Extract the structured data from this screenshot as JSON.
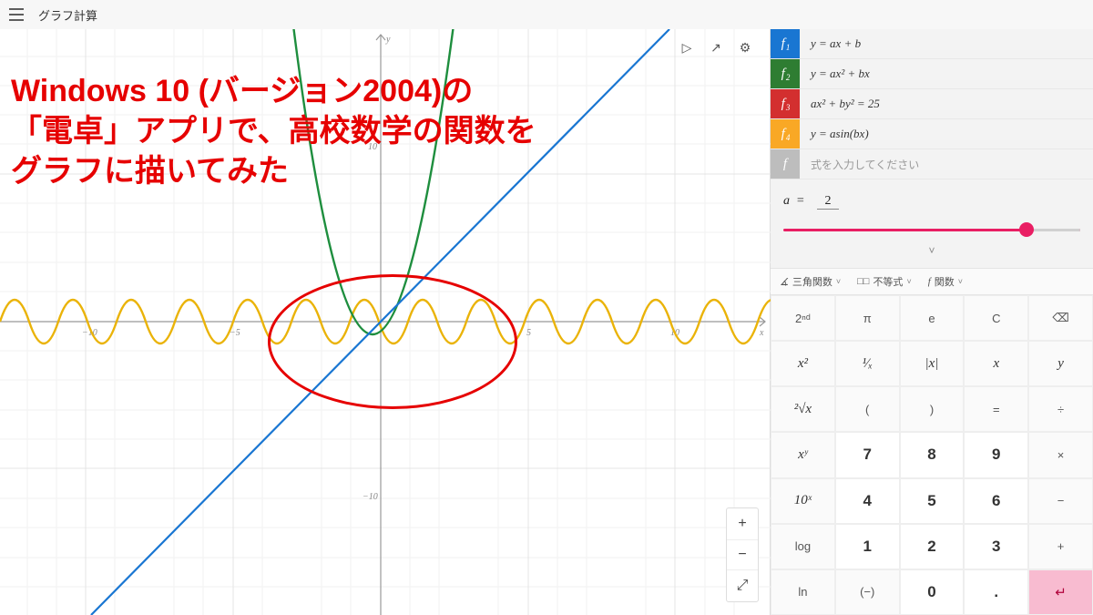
{
  "title": "グラフ計算",
  "overlay_text": "Windows 10 (バージョン2004)の\n「電卓」アプリで、高校数学の関数を\nグラフに描いてみた",
  "graph_tools": {
    "trace": "▷",
    "share": "↗",
    "options": "⚙"
  },
  "zoom": {
    "in": "+",
    "out": "−",
    "fit": "⤢"
  },
  "axes": {
    "x_ticks": [
      -10,
      -5,
      5,
      10
    ],
    "y_ticks": [
      10,
      -10
    ],
    "x_label": "x",
    "y_label": "y"
  },
  "functions": [
    {
      "color": "#1976d2",
      "chip": "f",
      "sub": "1",
      "expr_html": "y = ax + b"
    },
    {
      "color": "#2e7d32",
      "chip": "f",
      "sub": "2",
      "expr_html": "y = ax² + bx"
    },
    {
      "color": "#d32f2f",
      "chip": "f",
      "sub": "3",
      "expr_html": "ax² + by² = 25"
    },
    {
      "color": "#f9a825",
      "chip": "f",
      "sub": "4",
      "expr_html": "y = asin(bx)"
    }
  ],
  "input_placeholder": "式を入力してください",
  "slider": {
    "var": "a",
    "eq": "=",
    "value": "2",
    "position": 0.82
  },
  "categories": [
    {
      "icon": "∡",
      "label": "三角関数"
    },
    {
      "icon": "□□",
      "label": "不等式"
    },
    {
      "icon": "f",
      "label": "関数"
    }
  ],
  "keypad": [
    [
      {
        "t": "2ⁿᵈ",
        "k": "func"
      },
      {
        "t": "π",
        "k": "func"
      },
      {
        "t": "e",
        "k": "func"
      },
      {
        "t": "C",
        "k": "func"
      },
      {
        "t": "⌫",
        "k": "func"
      }
    ],
    [
      {
        "t": "x²",
        "k": "sym"
      },
      {
        "t": "¹⁄ₓ",
        "k": "sym"
      },
      {
        "t": "|x|",
        "k": "sym"
      },
      {
        "t": "x",
        "k": "sym"
      },
      {
        "t": "y",
        "k": "sym"
      }
    ],
    [
      {
        "t": "²√x",
        "k": "sym"
      },
      {
        "t": "(",
        "k": "func"
      },
      {
        "t": ")",
        "k": "func"
      },
      {
        "t": "=",
        "k": "func"
      },
      {
        "t": "÷",
        "k": "func"
      }
    ],
    [
      {
        "t": "xʸ",
        "k": "sym"
      },
      {
        "t": "7",
        "k": "num"
      },
      {
        "t": "8",
        "k": "num"
      },
      {
        "t": "9",
        "k": "num"
      },
      {
        "t": "×",
        "k": "func"
      }
    ],
    [
      {
        "t": "10ˣ",
        "k": "sym"
      },
      {
        "t": "4",
        "k": "num"
      },
      {
        "t": "5",
        "k": "num"
      },
      {
        "t": "6",
        "k": "num"
      },
      {
        "t": "−",
        "k": "func"
      }
    ],
    [
      {
        "t": "log",
        "k": "func"
      },
      {
        "t": "1",
        "k": "num"
      },
      {
        "t": "2",
        "k": "num"
      },
      {
        "t": "3",
        "k": "num"
      },
      {
        "t": "+",
        "k": "func"
      }
    ],
    [
      {
        "t": "ln",
        "k": "func"
      },
      {
        "t": "(−)",
        "k": "func"
      },
      {
        "t": "0",
        "k": "num"
      },
      {
        "t": ".",
        "k": "num"
      },
      {
        "t": "↵",
        "k": "enter"
      }
    ]
  ],
  "chart_data": {
    "type": "line",
    "title": "",
    "xlabel": "x",
    "ylabel": "y",
    "xlim": [
      -13,
      13
    ],
    "ylim": [
      -10,
      10
    ],
    "series": [
      {
        "name": "f1: y = 2x + b",
        "color": "#1976d2",
        "x": [
          -13,
          -10,
          -5,
          0,
          5,
          10,
          13
        ],
        "y": [
          -26,
          -20,
          -10,
          0,
          10,
          20,
          26
        ]
      },
      {
        "name": "f2: y = 2x² + bx",
        "color": "#2e7d32",
        "x": [
          -3,
          -2,
          -1,
          -0.5,
          0,
          0.5,
          1,
          2,
          3
        ],
        "y": [
          18,
          8,
          2,
          0.5,
          0,
          0.5,
          2,
          8,
          18
        ]
      },
      {
        "name": "f4: y = 2sin(bx)",
        "color": "#f9a825",
        "x": [
          -12,
          -11,
          -10,
          -9,
          -8,
          -7,
          -6,
          -5,
          -4,
          -3,
          -2,
          -1,
          0,
          1,
          2,
          3,
          4,
          5,
          6,
          7,
          8,
          9,
          10,
          11,
          12
        ],
        "y": [
          0,
          2,
          0,
          -2,
          0,
          2,
          0,
          -2,
          0,
          2,
          0,
          -2,
          0,
          2,
          0,
          -2,
          0,
          2,
          0,
          -2,
          0,
          2,
          0,
          -2,
          0
        ]
      }
    ]
  }
}
